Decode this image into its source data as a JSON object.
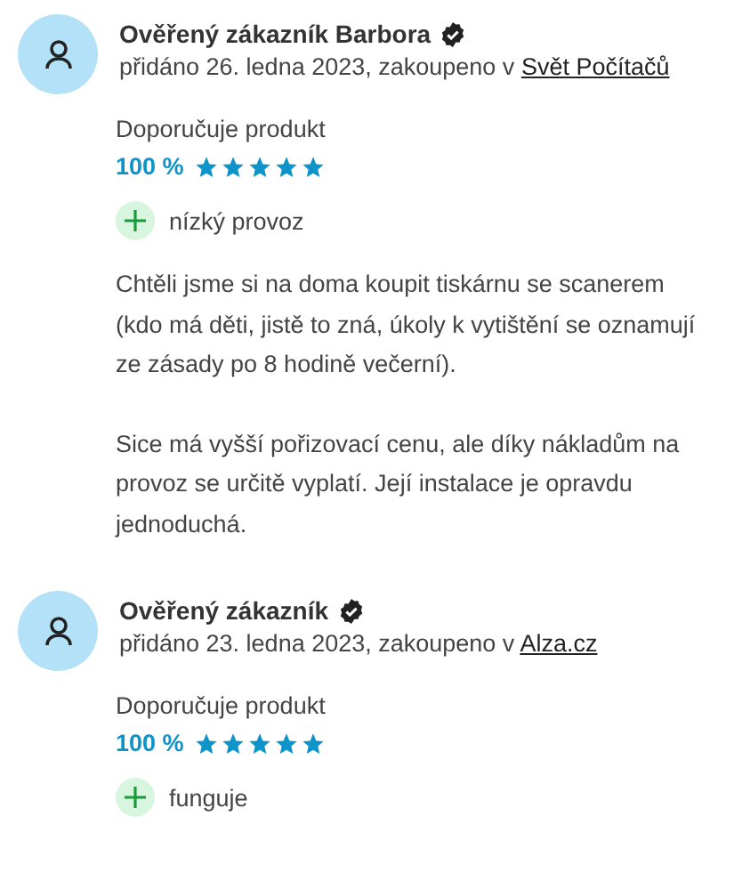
{
  "reviews": [
    {
      "author": "Ověřený zákazník Barbora",
      "verified": true,
      "added": "přidáno 26. ledna 2023, zakoupeno v ",
      "shop": "Svět Počítačů",
      "recommend": "Doporučuje produkt",
      "percent": "100 %",
      "stars": 5,
      "pros": [
        "nízký provoz"
      ],
      "paragraphs": [
        "Chtěli jsme si na doma koupit tiskárnu se scanerem (kdo má děti, jistě to zná, úkoly k vytištění se oznamují ze zásady po 8 hodině večerní).",
        "Sice má vyšší pořizovací cenu, ale díky nákladům na provoz se určitě vyplatí. Její instalace je opravdu jednoduchá."
      ]
    },
    {
      "author": "Ověřený zákazník",
      "verified": true,
      "added": "přidáno 23. ledna 2023, zakoupeno v ",
      "shop": "Alza.cz",
      "recommend": "Doporučuje produkt",
      "percent": "100 %",
      "stars": 5,
      "pros": [
        "funguje"
      ]
    }
  ]
}
